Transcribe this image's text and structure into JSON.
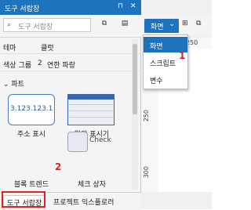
{
  "toolbox": {
    "title": "도구 서랍장",
    "pin": "⊓",
    "close": "✕",
    "search_placeholder": "도구 서랍장",
    "theme_label": "테마",
    "theme_value": "클럿",
    "color_group_label": "색상 그룹",
    "color_group_num": "2",
    "color_group_value": "연한 파랑",
    "section_title": "파트",
    "items": [
      {
        "caption": "주소 표시",
        "preview": "3.123.123.1"
      },
      {
        "caption": "알람 표시기",
        "preview": ""
      },
      {
        "caption": "블록 트렌드",
        "preview": ""
      },
      {
        "caption": "체크 상자",
        "preview": "Check"
      }
    ]
  },
  "bottom_tabs": {
    "toolbox": "도구 서랍장",
    "project_explorer": "프로젝트 익스플로러"
  },
  "designer": {
    "screen_button": "화면",
    "dropdown": [
      "화면",
      "스크립트",
      "변수"
    ],
    "ruler_x": "-250",
    "ruler_y": [
      "250",
      "300"
    ]
  },
  "annotations": {
    "one": "1",
    "two": "2"
  }
}
